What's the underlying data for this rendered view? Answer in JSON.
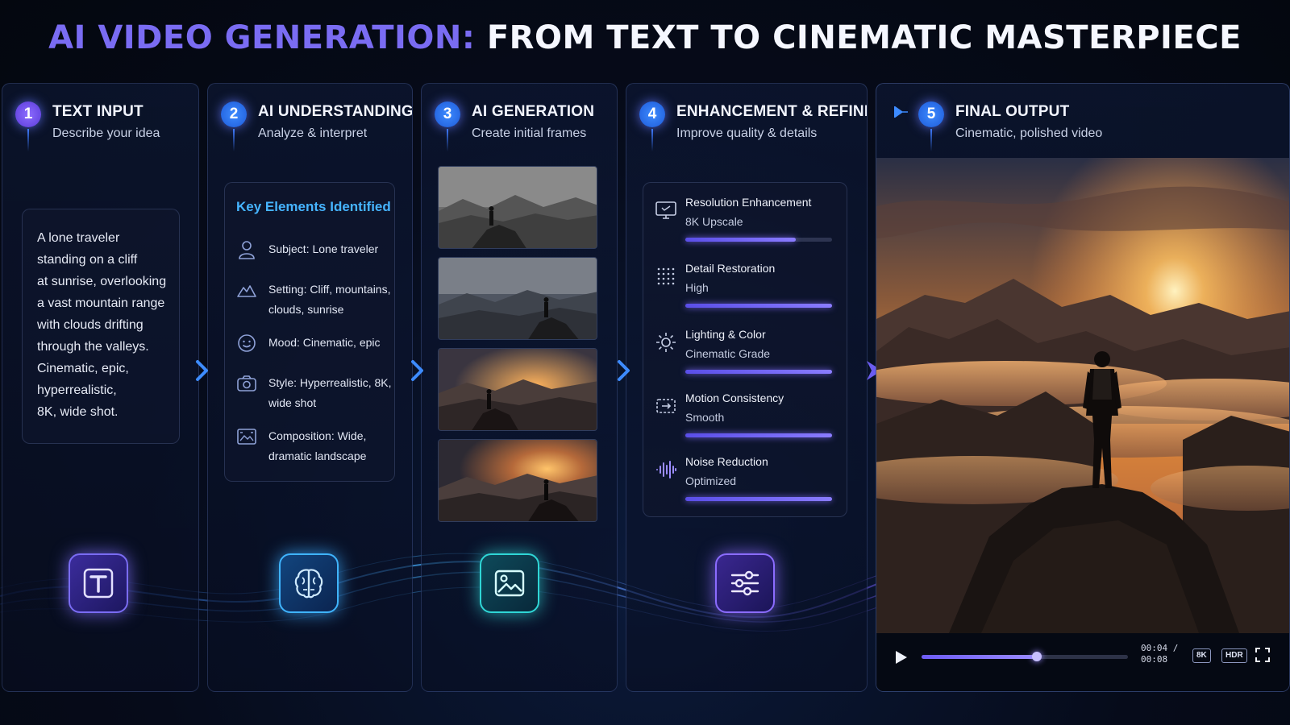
{
  "header": {
    "title_accent": "AI VIDEO GENERATION:",
    "title_main": "FROM TEXT TO CINEMATIC MASTERPIECE"
  },
  "steps": [
    {
      "number": "1",
      "title": "TEXT INPUT",
      "subtitle": "Describe your idea"
    },
    {
      "number": "2",
      "title": "AI UNDERSTANDING",
      "subtitle": "Analyze & interpret"
    },
    {
      "number": "3",
      "title": "AI GENERATION",
      "subtitle": "Create initial frames"
    },
    {
      "number": "4",
      "title": "ENHANCEMENT & REFINEMENT",
      "subtitle": "Improve quality & details"
    },
    {
      "number": "5",
      "title": "FINAL OUTPUT",
      "subtitle": "Cinematic, polished video"
    }
  ],
  "prompt": {
    "lines": [
      "A lone traveler",
      "standing on a cliff",
      "at sunrise, overlooking",
      "a vast mountain range",
      "with clouds drifting",
      "through the valleys.",
      "Cinematic, epic,",
      "hyperrealistic,",
      "8K, wide shot."
    ]
  },
  "understanding": {
    "box_title": "Key Elements Identified",
    "elements": [
      {
        "icon": "person-icon",
        "line1": "Subject: Lone traveler",
        "line2": ""
      },
      {
        "icon": "mountain-icon",
        "line1": "Setting: Cliff, mountains,",
        "line2": "clouds, sunrise"
      },
      {
        "icon": "smile-icon",
        "line1": "Mood: Cinematic, epic",
        "line2": ""
      },
      {
        "icon": "camera-icon",
        "line1": "Style: Hyperrealistic, 8K,",
        "line2": "wide shot"
      },
      {
        "icon": "frame-icon",
        "line1": "Composition: Wide,",
        "line2": "dramatic landscape"
      }
    ]
  },
  "enhancements": [
    {
      "icon": "monitor-icon",
      "label": "Resolution Enhancement",
      "value": "8K Upscale",
      "progress": 0.75
    },
    {
      "icon": "grid-dots-icon",
      "label": "Detail Restoration",
      "value": "High",
      "progress": 1.0
    },
    {
      "icon": "sun-icon",
      "label": "Lighting & Color",
      "value": "Cinematic Grade",
      "progress": 1.0
    },
    {
      "icon": "motion-icon",
      "label": "Motion Consistency",
      "value": "Smooth",
      "progress": 1.0
    },
    {
      "icon": "waveform-icon",
      "label": "Noise Reduction",
      "value": "Optimized",
      "progress": 1.0
    }
  ],
  "player": {
    "time_current": "00:04 /",
    "time_total": "00:08",
    "tag_resolution": "8K",
    "tag_hdr": "HDR",
    "progress": 0.56
  },
  "colors": {
    "accent_purple": "#7a6cf3",
    "accent_blue": "#3d8bff",
    "highlight_cyan": "#46b4ff",
    "background": "#060b1a"
  }
}
